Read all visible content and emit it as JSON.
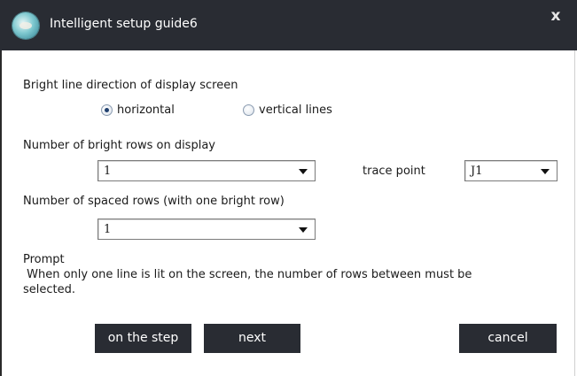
{
  "window": {
    "title": "Intelligent setup guide6",
    "close_label": "x"
  },
  "direction": {
    "label": "Bright line direction of display screen",
    "options": [
      {
        "label": "horizontal",
        "selected": true
      },
      {
        "label": "vertical lines",
        "selected": false
      }
    ]
  },
  "bright_rows": {
    "label": "Number of bright rows on display",
    "selected": "1"
  },
  "trace_point": {
    "label": "trace point",
    "selected": "J1"
  },
  "spaced_rows": {
    "label": "Number of spaced rows (with one bright row)",
    "selected": "1"
  },
  "prompt": {
    "heading": "Prompt",
    "line1": " When only one line is lit on the screen, the number of rows between must be",
    "line2": "selected."
  },
  "buttons": {
    "prev": "on the step",
    "next": "next",
    "cancel": "cancel"
  },
  "colors": {
    "titlebar": "#292c33",
    "button": "#292c33",
    "background": "#ffffff"
  }
}
